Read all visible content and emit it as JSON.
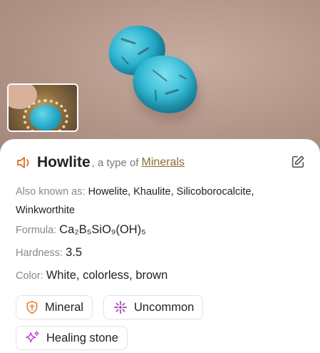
{
  "specimen": {
    "name": "Howlite",
    "type_prefix": ", a type of",
    "category": "Minerals"
  },
  "details": {
    "aka_label": "Also known as:",
    "aka_value": "Howelite, Khaulite, Silicoborocalcite, Winkworthite",
    "formula_label": "Formula:",
    "formula_value": "Ca₂B₅SiO₉(OH)₅",
    "hardness_label": "Hardness:",
    "hardness_value": "3.5",
    "color_label": "Color:",
    "color_value": "White, colorless, brown"
  },
  "tags": [
    {
      "label": "Mineral",
      "icon": "shield-icon"
    },
    {
      "label": "Uncommon",
      "icon": "sparkle-icon"
    },
    {
      "label": "Healing stone",
      "icon": "sparkles-icon"
    }
  ],
  "colors": {
    "accent": "#e07a2e",
    "link": "#8a6d2f",
    "uncommon": "#9b3fb5",
    "healing": "#c23ad1"
  }
}
